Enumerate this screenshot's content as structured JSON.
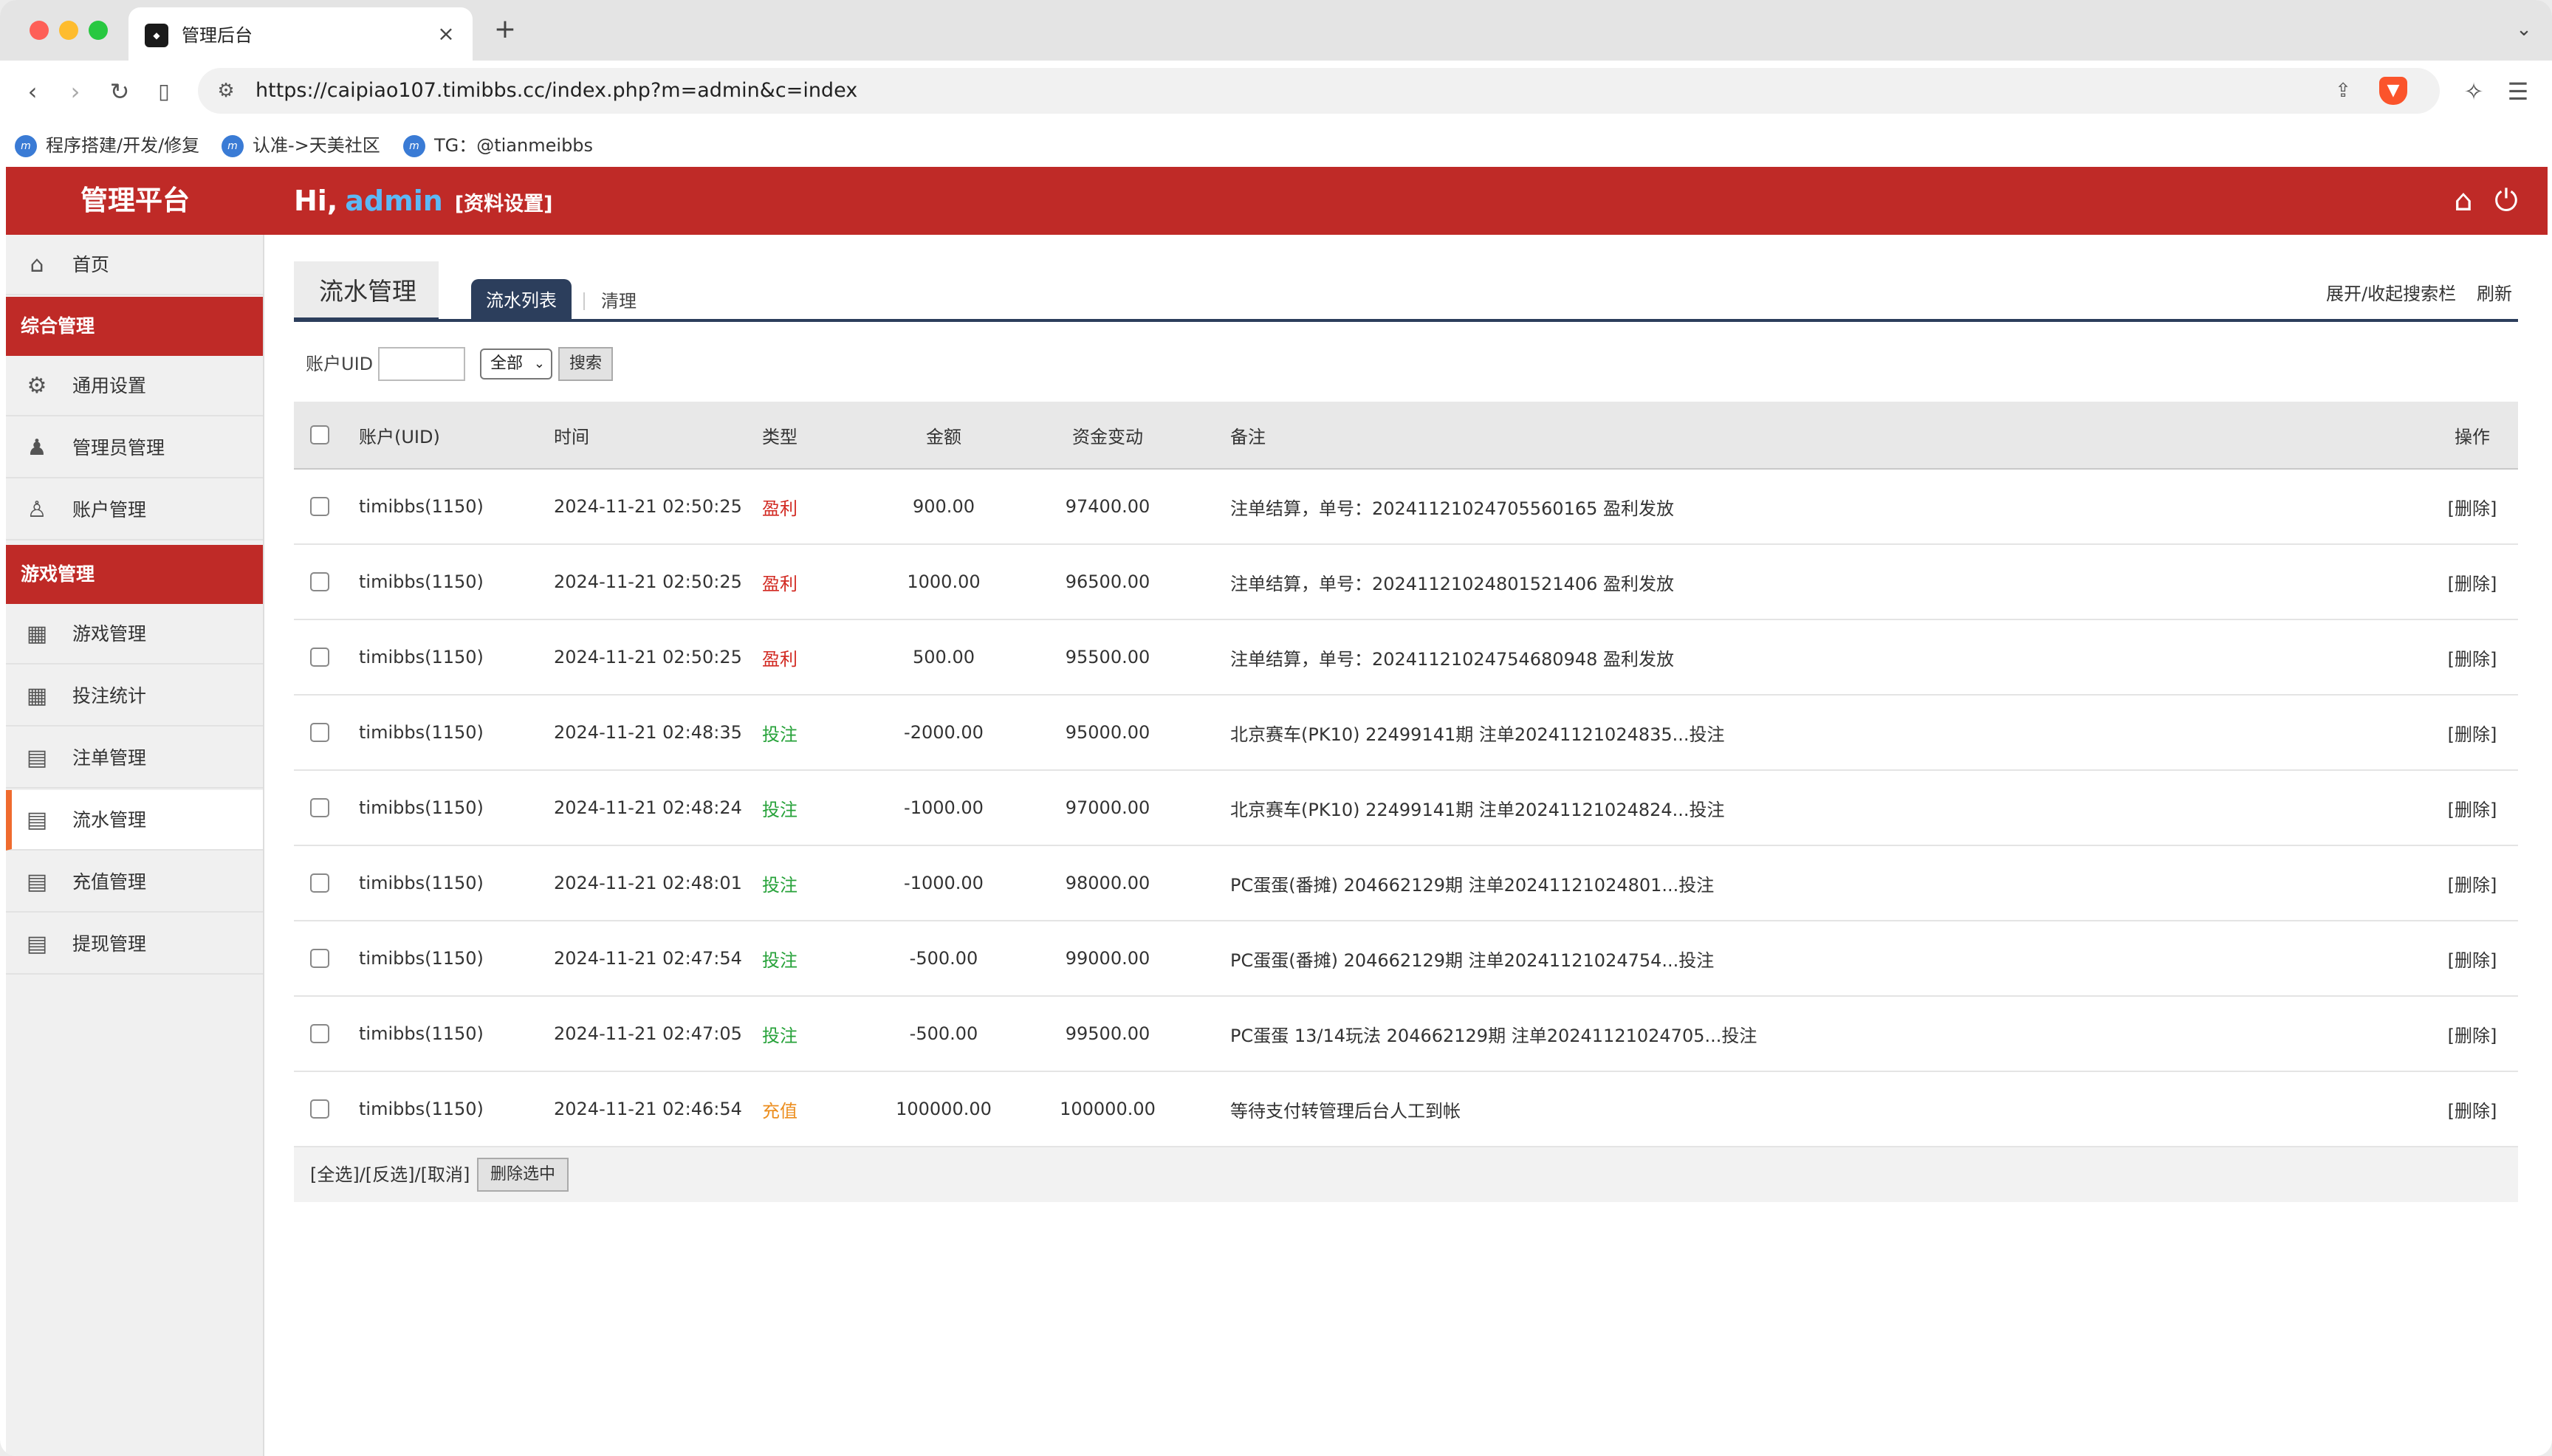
{
  "browser": {
    "tab_title": "管理后台",
    "url": "https://caipiao107.timibbs.cc/index.php?m=admin&c=index",
    "bookmarks": [
      "程序搭建/开发/修复",
      "认准->天美社区",
      "TG：@tianmeibbs"
    ]
  },
  "header": {
    "brand": "管理平台",
    "greeting": "Hi,",
    "username": "admin",
    "profile_link": "[资料设置]"
  },
  "sidebar": {
    "home": "首页",
    "group1": "综合管理",
    "group1_items": [
      "通用设置",
      "管理员管理",
      "账户管理"
    ],
    "group2": "游戏管理",
    "group2_items": [
      "游戏管理",
      "投注统计",
      "注单管理",
      "流水管理",
      "充值管理",
      "提现管理"
    ],
    "active_item": "流水管理"
  },
  "main": {
    "page_tab": "流水管理",
    "sub_tab_active": "流水列表",
    "sub_tab_other": "清理",
    "toggle_search": "展开/收起搜索栏",
    "refresh": "刷新",
    "search": {
      "uid_label": "账户UID",
      "uid_value": "",
      "select_value": "全部",
      "button": "搜索"
    },
    "columns": [
      "账户(UID)",
      "时间",
      "类型",
      "金额",
      "资金变动",
      "备注",
      "操作"
    ],
    "rows": [
      {
        "account": "timibbs(1150)",
        "time": "2024-11-21 02:50:25",
        "type": "盈利",
        "type_kind": "profit",
        "amount": "900.00",
        "balance": "97400.00",
        "note": "注单结算，单号：20241121024705560165 盈利发放",
        "action": "[删除]"
      },
      {
        "account": "timibbs(1150)",
        "time": "2024-11-21 02:50:25",
        "type": "盈利",
        "type_kind": "profit",
        "amount": "1000.00",
        "balance": "96500.00",
        "note": "注单结算，单号：20241121024801521406 盈利发放",
        "action": "[删除]"
      },
      {
        "account": "timibbs(1150)",
        "time": "2024-11-21 02:50:25",
        "type": "盈利",
        "type_kind": "profit",
        "amount": "500.00",
        "balance": "95500.00",
        "note": "注单结算，单号：20241121024754680948 盈利发放",
        "action": "[删除]"
      },
      {
        "account": "timibbs(1150)",
        "time": "2024-11-21 02:48:35",
        "type": "投注",
        "type_kind": "bet",
        "amount": "-2000.00",
        "balance": "95000.00",
        "note": "北京赛车(PK10) 22499141期 注单20241121024835...投注",
        "action": "[删除]"
      },
      {
        "account": "timibbs(1150)",
        "time": "2024-11-21 02:48:24",
        "type": "投注",
        "type_kind": "bet",
        "amount": "-1000.00",
        "balance": "97000.00",
        "note": "北京赛车(PK10) 22499141期 注单20241121024824...投注",
        "action": "[删除]"
      },
      {
        "account": "timibbs(1150)",
        "time": "2024-11-21 02:48:01",
        "type": "投注",
        "type_kind": "bet",
        "amount": "-1000.00",
        "balance": "98000.00",
        "note": "PC蛋蛋(番摊) 204662129期 注单20241121024801...投注",
        "action": "[删除]"
      },
      {
        "account": "timibbs(1150)",
        "time": "2024-11-21 02:47:54",
        "type": "投注",
        "type_kind": "bet",
        "amount": "-500.00",
        "balance": "99000.00",
        "note": "PC蛋蛋(番摊) 204662129期 注单20241121024754...投注",
        "action": "[删除]"
      },
      {
        "account": "timibbs(1150)",
        "time": "2024-11-21 02:47:05",
        "type": "投注",
        "type_kind": "bet",
        "amount": "-500.00",
        "balance": "99500.00",
        "note": "PC蛋蛋 13/14玩法 204662129期 注单20241121024705...投注",
        "action": "[删除]"
      },
      {
        "account": "timibbs(1150)",
        "time": "2024-11-21 02:46:54",
        "type": "充值",
        "type_kind": "recharge",
        "amount": "100000.00",
        "balance": "100000.00",
        "note": "等待支付转管理后台人工到帐",
        "action": "[删除]"
      }
    ],
    "footer": {
      "select_links": "[全选]/[反选]/[取消]",
      "delete_selected": "删除选中"
    }
  },
  "colors": {
    "header_red": "#bf2a27",
    "nav_dark": "#2c3e5c",
    "profit": "#d22a22",
    "bet": "#27a23a",
    "recharge": "#ec8e1f",
    "active_marker": "#ef6b2e",
    "username": "#5db8f5"
  }
}
